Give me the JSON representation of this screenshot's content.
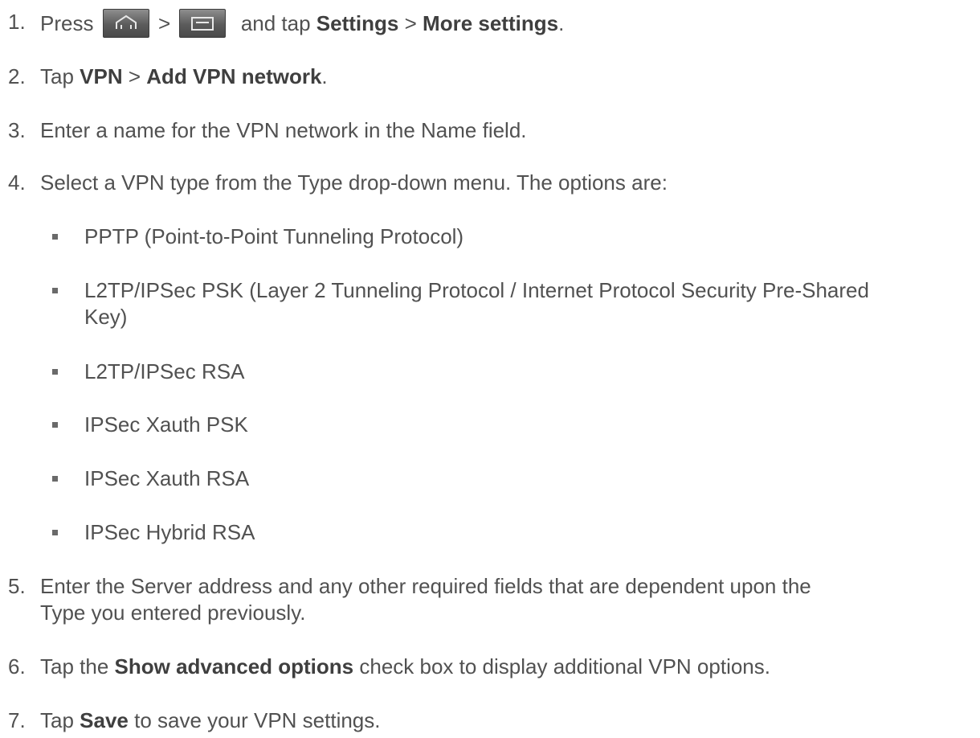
{
  "steps": [
    {
      "num": "1.",
      "a": "Press",
      "sep": ">",
      "b": "and tap",
      "bold1": "Settings",
      "mid": ">",
      "bold2": "More settings",
      "end": "."
    },
    {
      "num": "2.",
      "a": "Tap",
      "bold1": "VPN",
      "mid": ">",
      "bold2": "Add VPN network",
      "end": "."
    },
    {
      "num": "3.",
      "text": "Enter a name for the VPN network in the Name field."
    },
    {
      "num": "4.",
      "text": "Select a VPN type from the Type drop-down menu. The options are:"
    },
    {
      "num": "5.",
      "line1": "Enter the Server address and any other required fields that are dependent upon the",
      "line2": "Type you entered previously."
    },
    {
      "num": "6.",
      "a": "Tap the",
      "bold1": "Show advanced options",
      "b": "check box to display additional VPN options."
    },
    {
      "num": "7.",
      "a": "Tap",
      "bold1": "Save",
      "b": "to save your VPN settings."
    }
  ],
  "vpn_types": [
    "PPTP (Point-to-Point Tunneling Protocol)",
    "L2TP/IPSec PSK (Layer 2 Tunneling Protocol / Internet Protocol Security Pre-Shared",
    "Key)",
    "L2TP/IPSec RSA",
    "IPSec Xauth PSK",
    "IPSec Xauth RSA",
    "IPSec Hybrid RSA"
  ],
  "icons": [
    "home-key-icon",
    "menu-key-icon"
  ]
}
